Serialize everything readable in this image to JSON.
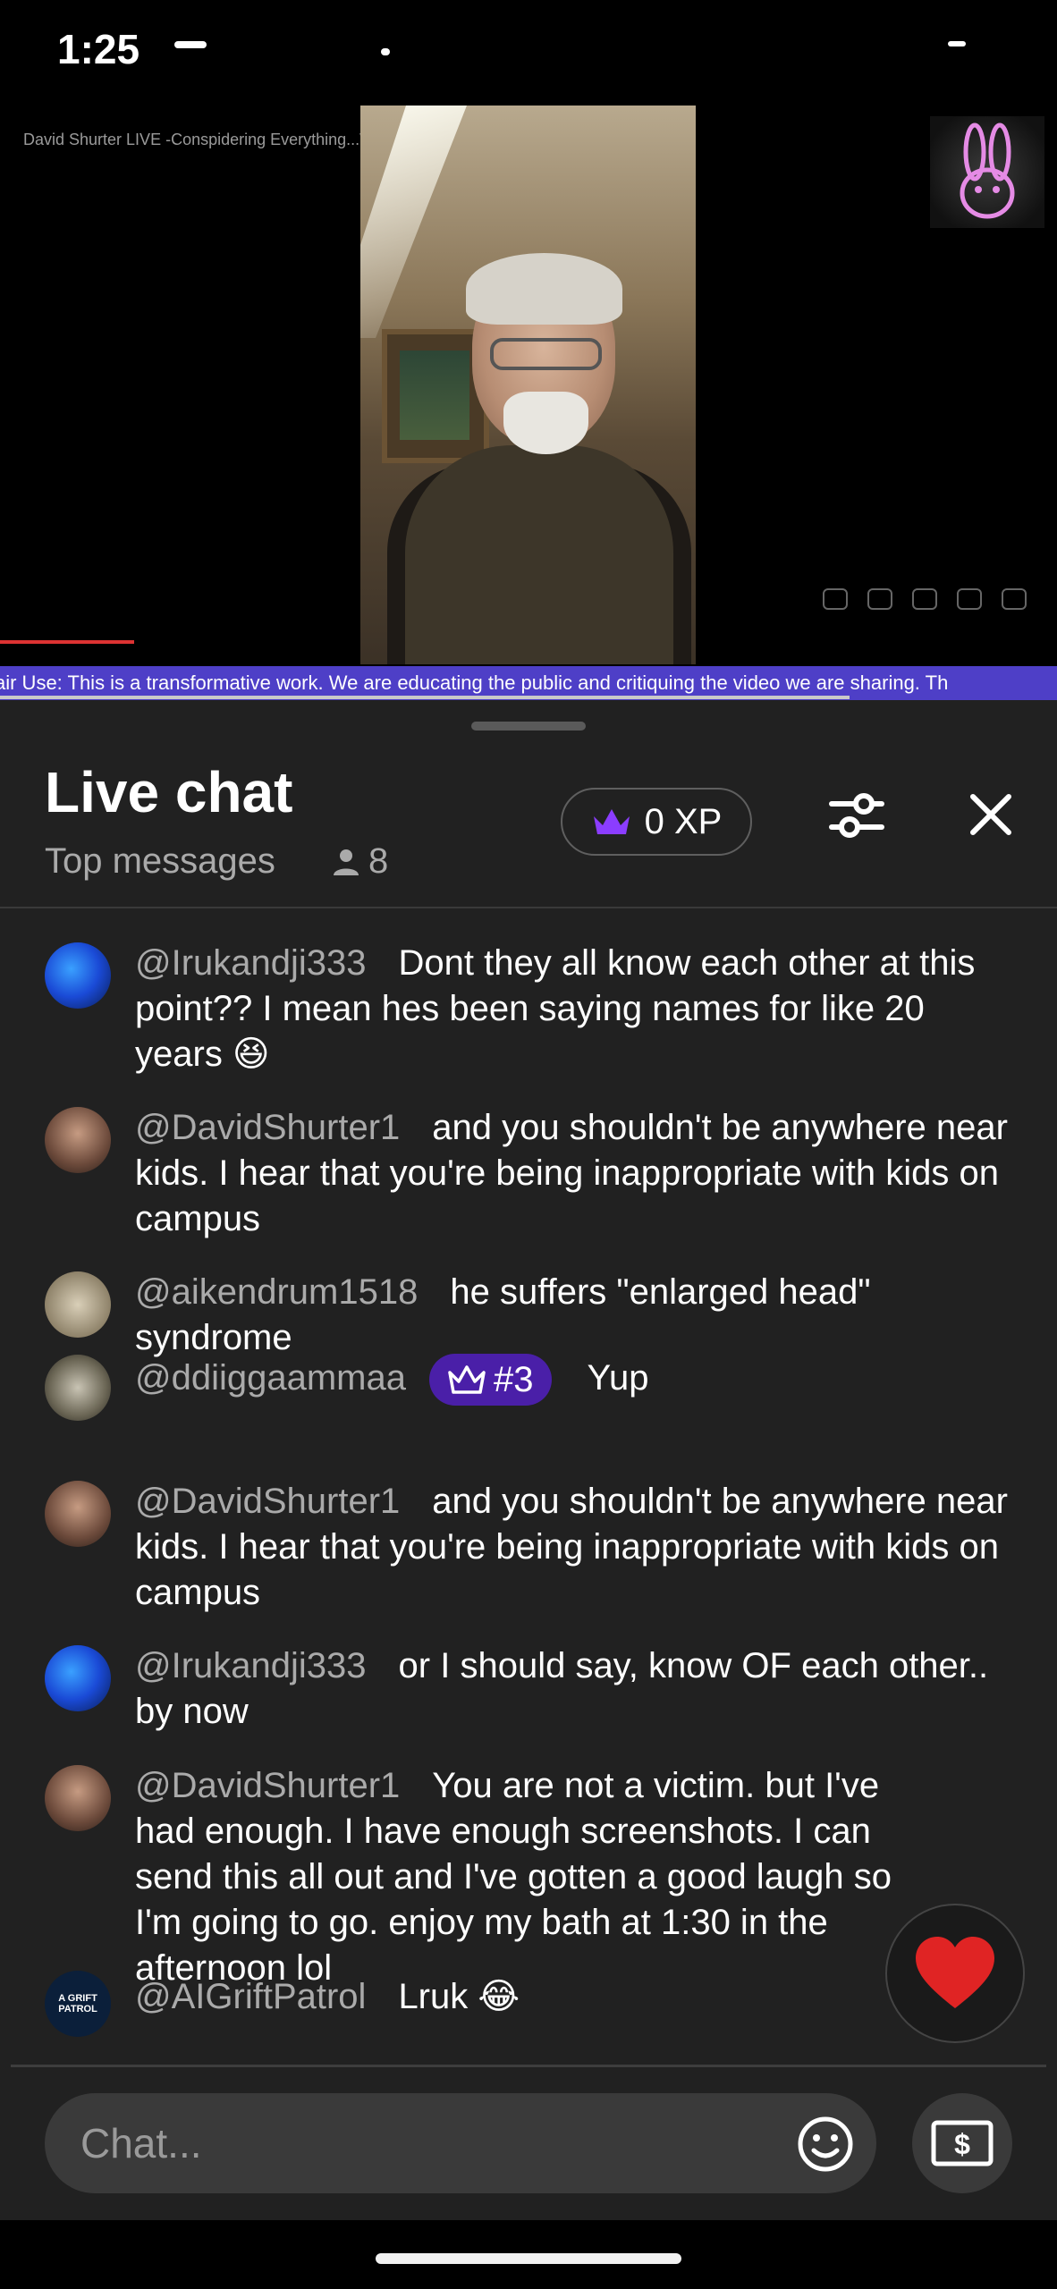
{
  "status_bar": {
    "time": "1:25"
  },
  "video": {
    "title": "David Shurter LIVE -Conspidering Everything...Was Chatting These...",
    "ticker": "air Use: This is a transformative work. We are educating the public and critiquing the video we are sharing. Th"
  },
  "chat": {
    "title": "Live chat",
    "mode": "Top messages",
    "viewers": "8",
    "xp": "0 XP",
    "messages": [
      {
        "author": "@Irukandji333",
        "text": "Dont they all know each other at this point?? I mean hes been saying names for like 20 years 😆",
        "avatar_color": "#1a4ad6"
      },
      {
        "author": "@DavidShurter1",
        "text": "and you shouldn't be anywhere near kids. I hear that you're being inappropriate with kids on campus",
        "avatar_color": "#7a5a48"
      },
      {
        "author": "@aikendrum1518",
        "text": "he suffers \"enlarged head\" syndrome",
        "avatar_color": "#b7a98c"
      },
      {
        "author": "@ddiiggaammaa",
        "badge": "#3",
        "text": "Yup",
        "avatar_color": "#5d5a4a"
      },
      {
        "author": "@DavidShurter1",
        "text": "and you shouldn't be anywhere near kids. I hear that you're being inappropriate with kids on campus",
        "avatar_color": "#7a5a48"
      },
      {
        "author": "@Irukandji333",
        "text": "or I should say, know OF each other.. by now",
        "avatar_color": "#1a4ad6"
      },
      {
        "author": "@DavidShurter1",
        "text": "You are not a victim. but I've had enough. I have enough screenshots. I can send this all out and I've gotten a good laugh so I'm going to go. enjoy my bath at 1:30 in the afternoon lol",
        "avatar_color": "#7a5a48"
      },
      {
        "author": "@AIGriftPatrol",
        "text": "Lruk 😂",
        "avatar_color": "#0b1f3a",
        "avatar_text": "A GRIFT PATROL"
      }
    ],
    "input_placeholder": "Chat..."
  },
  "icons": {
    "filter": "tune-sliders-icon",
    "close": "close-icon",
    "crown": "crown-icon",
    "person": "person-icon",
    "heart": "heart-icon",
    "emoji": "emoji-smile-icon",
    "superchat": "superchat-dollar-icon"
  },
  "colors": {
    "accent_purple": "#7b3ff2",
    "ticker": "#4e3fc7",
    "heart": "#e02424"
  }
}
